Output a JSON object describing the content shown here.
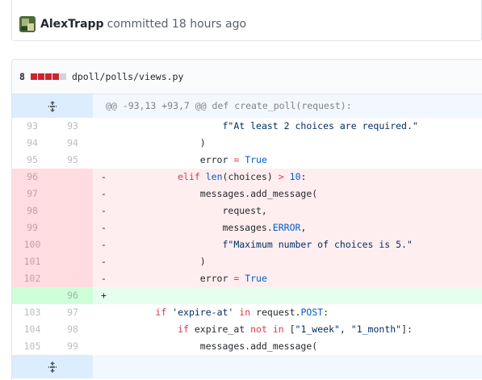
{
  "commit": {
    "author": "AlexTrapp",
    "text": "committed 18 hours ago"
  },
  "file": {
    "changes": "8",
    "path": "dpoll/polls/views.py",
    "diffstat": [
      "del",
      "del",
      "del",
      "del",
      "neutral"
    ]
  },
  "hunks": {
    "top": "@@ -93,13 +93,7 @@ def create_poll(request):",
    "bottom": ""
  },
  "lines": [
    {
      "type": "ctx",
      "old": "93",
      "new": "93",
      "sign": "",
      "tokens": [
        {
          "c": "txt",
          "t": "                    "
        },
        {
          "c": "str",
          "t": "f\"At least 2 choices are required.\""
        }
      ]
    },
    {
      "type": "ctx",
      "old": "94",
      "new": "94",
      "sign": "",
      "tokens": [
        {
          "c": "txt",
          "t": "                )"
        }
      ]
    },
    {
      "type": "ctx",
      "old": "95",
      "new": "95",
      "sign": "",
      "tokens": [
        {
          "c": "txt",
          "t": "                error "
        },
        {
          "c": "kw",
          "t": "="
        },
        {
          "c": "txt",
          "t": " "
        },
        {
          "c": "cst",
          "t": "True"
        }
      ]
    },
    {
      "type": "del",
      "old": "96",
      "new": "",
      "sign": "-",
      "tokens": [
        {
          "c": "txt",
          "t": "            "
        },
        {
          "c": "kw",
          "t": "elif"
        },
        {
          "c": "txt",
          "t": " "
        },
        {
          "c": "cst",
          "t": "len"
        },
        {
          "c": "txt",
          "t": "(choices) "
        },
        {
          "c": "kw",
          "t": ">"
        },
        {
          "c": "txt",
          "t": " "
        },
        {
          "c": "cst",
          "t": "10"
        },
        {
          "c": "txt",
          "t": ":"
        }
      ]
    },
    {
      "type": "del",
      "old": "97",
      "new": "",
      "sign": "-",
      "tokens": [
        {
          "c": "txt",
          "t": "                messages.add_message("
        }
      ]
    },
    {
      "type": "del",
      "old": "98",
      "new": "",
      "sign": "-",
      "tokens": [
        {
          "c": "txt",
          "t": "                    request,"
        }
      ]
    },
    {
      "type": "del",
      "old": "99",
      "new": "",
      "sign": "-",
      "tokens": [
        {
          "c": "txt",
          "t": "                    messages."
        },
        {
          "c": "cst",
          "t": "ERROR"
        },
        {
          "c": "txt",
          "t": ","
        }
      ]
    },
    {
      "type": "del",
      "old": "100",
      "new": "",
      "sign": "-",
      "tokens": [
        {
          "c": "txt",
          "t": "                    "
        },
        {
          "c": "str",
          "t": "f\"Maximum number of choices is 5.\""
        }
      ]
    },
    {
      "type": "del",
      "old": "101",
      "new": "",
      "sign": "-",
      "tokens": [
        {
          "c": "txt",
          "t": "                )"
        }
      ]
    },
    {
      "type": "del",
      "old": "102",
      "new": "",
      "sign": "-",
      "tokens": [
        {
          "c": "txt",
          "t": "                error "
        },
        {
          "c": "kw",
          "t": "="
        },
        {
          "c": "txt",
          "t": " "
        },
        {
          "c": "cst",
          "t": "True"
        }
      ]
    },
    {
      "type": "add",
      "old": "",
      "new": "96",
      "sign": "+",
      "tokens": [
        {
          "c": "txt",
          "t": ""
        }
      ]
    },
    {
      "type": "ctx",
      "old": "103",
      "new": "97",
      "sign": "",
      "tokens": [
        {
          "c": "txt",
          "t": "        "
        },
        {
          "c": "kw",
          "t": "if"
        },
        {
          "c": "txt",
          "t": " "
        },
        {
          "c": "str",
          "t": "'expire-at'"
        },
        {
          "c": "txt",
          "t": " "
        },
        {
          "c": "kw",
          "t": "in"
        },
        {
          "c": "txt",
          "t": " request."
        },
        {
          "c": "cst",
          "t": "POST"
        },
        {
          "c": "txt",
          "t": ":"
        }
      ]
    },
    {
      "type": "ctx",
      "old": "104",
      "new": "98",
      "sign": "",
      "tokens": [
        {
          "c": "txt",
          "t": "            "
        },
        {
          "c": "kw",
          "t": "if"
        },
        {
          "c": "txt",
          "t": " expire_at "
        },
        {
          "c": "kw",
          "t": "not in"
        },
        {
          "c": "txt",
          "t": " ["
        },
        {
          "c": "str",
          "t": "\"1_week\""
        },
        {
          "c": "txt",
          "t": ", "
        },
        {
          "c": "str",
          "t": "\"1_month\""
        },
        {
          "c": "txt",
          "t": "]:"
        }
      ]
    },
    {
      "type": "ctx",
      "old": "105",
      "new": "99",
      "sign": "",
      "tokens": [
        {
          "c": "txt",
          "t": "                messages.add_message("
        }
      ]
    }
  ],
  "colors": {
    "deletion": "#cb2431",
    "hunk_bg": "#f1f8ff",
    "expander_bg": "#dbedff",
    "del_bg": "#ffeef0",
    "add_bg": "#e6ffed"
  },
  "icons": {
    "expand": "unfold-icon"
  }
}
